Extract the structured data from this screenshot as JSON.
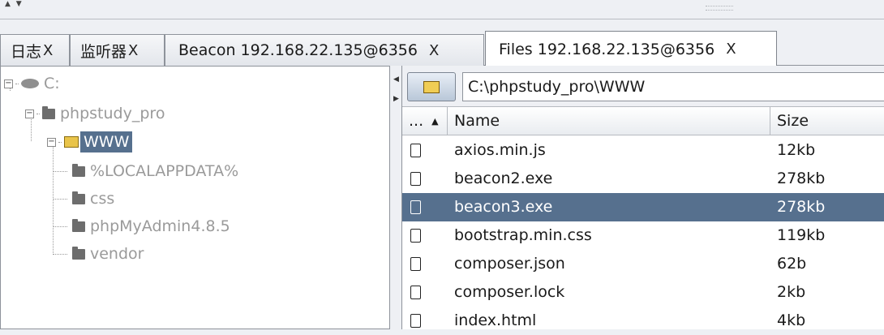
{
  "tabs": [
    {
      "label": "日志",
      "close": "X"
    },
    {
      "label": "监听器",
      "close": "X"
    },
    {
      "label": "Beacon 192.168.22.135@6356",
      "close": "X"
    },
    {
      "label": "Files 192.168.22.135@6356",
      "close": "X",
      "active": true
    }
  ],
  "tree": {
    "drive": "C:",
    "folder1": "phpstudy_pro",
    "folder2": "WWW",
    "children": [
      "%LOCALAPPDATA%",
      "css",
      "phpMyAdmin4.8.5",
      "vendor"
    ]
  },
  "path": {
    "value": "C:\\phpstudy_pro\\WWW"
  },
  "table": {
    "headers": {
      "c0": "...",
      "sort": "▲",
      "name": "Name",
      "size": "Size"
    },
    "rows": [
      {
        "name": "axios.min.js",
        "size": "12kb"
      },
      {
        "name": "beacon2.exe",
        "size": "278kb"
      },
      {
        "name": "beacon3.exe",
        "size": "278kb",
        "selected": true
      },
      {
        "name": "bootstrap.min.css",
        "size": "119kb"
      },
      {
        "name": "composer.json",
        "size": "62b"
      },
      {
        "name": "composer.lock",
        "size": "2kb"
      },
      {
        "name": "index.html",
        "size": "4kb"
      }
    ]
  },
  "icons": {
    "folder_button": "folder-icon",
    "file": "file-icon",
    "drive": "drive-icon"
  },
  "colors": {
    "selection": "#56708e",
    "folder_yellow": "#e9c44a"
  }
}
